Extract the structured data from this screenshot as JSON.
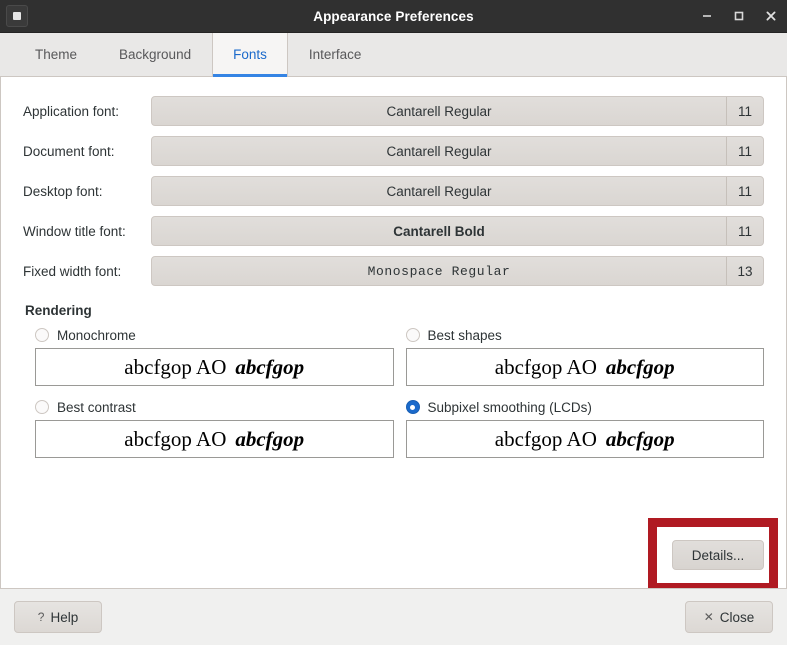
{
  "window": {
    "title": "Appearance Preferences",
    "icon": "window-menu-icon",
    "minimize_label": "–",
    "maximize_label": "□",
    "close_label": "✕"
  },
  "tabs": [
    {
      "label": "Theme",
      "active": false
    },
    {
      "label": "Background",
      "active": false
    },
    {
      "label": "Fonts",
      "active": true
    },
    {
      "label": "Interface",
      "active": false
    }
  ],
  "font_rows": [
    {
      "label": "Application font:",
      "value": "Cantarell Regular",
      "size": "11",
      "style": "regular"
    },
    {
      "label": "Document font:",
      "value": "Cantarell Regular",
      "size": "11",
      "style": "regular"
    },
    {
      "label": "Desktop font:",
      "value": "Cantarell Regular",
      "size": "11",
      "style": "regular"
    },
    {
      "label": "Window title font:",
      "value": "Cantarell Bold",
      "size": "11",
      "style": "bold"
    },
    {
      "label": "Fixed width font:",
      "value": "Monospace Regular",
      "size": "13",
      "style": "mono"
    }
  ],
  "rendering": {
    "title": "Rendering",
    "options": [
      {
        "label": "Monochrome",
        "selected": false,
        "preview_regular": "abcfgop AO",
        "preview_italic": "abcfgop"
      },
      {
        "label": "Best shapes",
        "selected": false,
        "preview_regular": "abcfgop AO",
        "preview_italic": "abcfgop"
      },
      {
        "label": "Best contrast",
        "selected": false,
        "preview_regular": "abcfgop AO",
        "preview_italic": "abcfgop"
      },
      {
        "label": "Subpixel smoothing (LCDs)",
        "selected": true,
        "preview_regular": "abcfgop AO",
        "preview_italic": "abcfgop"
      }
    ],
    "details_label": "Details..."
  },
  "actions": {
    "help_glyph": "?",
    "help_label": "Help",
    "close_glyph": "✕",
    "close_label": "Close"
  },
  "colors": {
    "accent": "#3584e4",
    "accent_text": "#1b6acb",
    "highlight_box": "#b01a22",
    "titlebar": "#303030"
  }
}
